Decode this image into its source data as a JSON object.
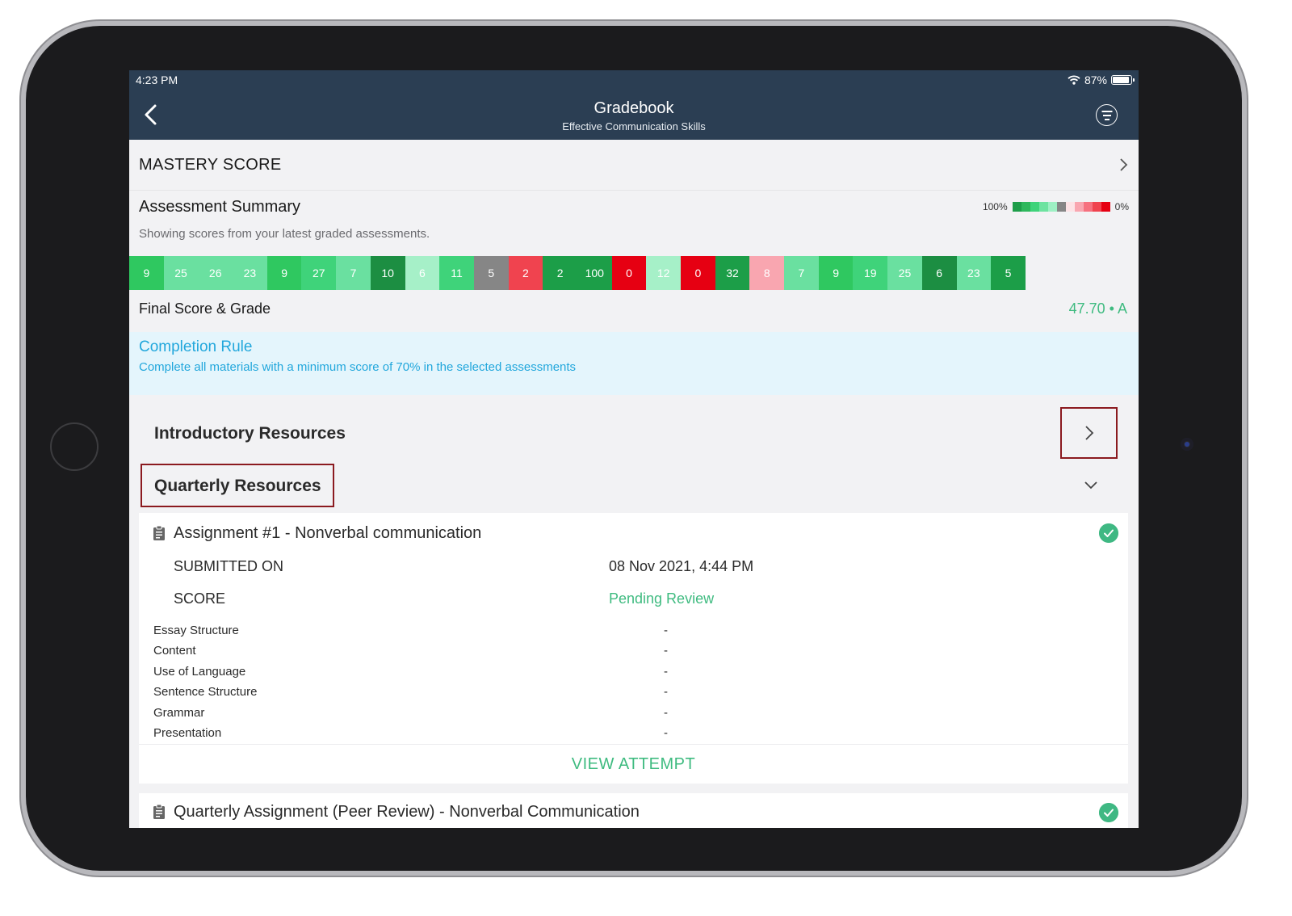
{
  "status": {
    "time": "4:23 PM",
    "battery": "87%"
  },
  "header": {
    "title": "Gradebook",
    "subtitle": "Effective Communication Skills"
  },
  "mastery": {
    "label": "MASTERY SCORE"
  },
  "summary": {
    "title": "Assessment Summary",
    "note": "Showing scores from your latest graded assessments.",
    "legend_high": "100%",
    "legend_low": "0%",
    "legend_colors": [
      "#1e9e4a",
      "#2eb85c",
      "#3fd37a",
      "#6ee3a0",
      "#9ef0c4",
      "#868686",
      "#fde3e6",
      "#f9a6b0",
      "#f6717f",
      "#f0434f",
      "#e60012"
    ],
    "scores": [
      {
        "v": "9",
        "c": "#2fc860"
      },
      {
        "v": "25",
        "c": "#6ae0a0"
      },
      {
        "v": "26",
        "c": "#6ae0a0"
      },
      {
        "v": "23",
        "c": "#6ae0a0"
      },
      {
        "v": "9",
        "c": "#2fc860"
      },
      {
        "v": "27",
        "c": "#3fd37a"
      },
      {
        "v": "7",
        "c": "#6ae0a0"
      },
      {
        "v": "10",
        "c": "#1c8e42"
      },
      {
        "v": "6",
        "c": "#a6f0c8"
      },
      {
        "v": "11",
        "c": "#3fd37a"
      },
      {
        "v": "5",
        "c": "#868686"
      },
      {
        "v": "2",
        "c": "#f0434f"
      },
      {
        "v": "2",
        "c": "#1c9e48"
      },
      {
        "v": "100",
        "c": "#1c9e48"
      },
      {
        "v": "0",
        "c": "#e60012"
      },
      {
        "v": "12",
        "c": "#a6f0c8"
      },
      {
        "v": "0",
        "c": "#e60012"
      },
      {
        "v": "32",
        "c": "#1c9e48"
      },
      {
        "v": "8",
        "c": "#f9a6b0"
      },
      {
        "v": "7",
        "c": "#6ae0a0"
      },
      {
        "v": "9",
        "c": "#2fc860"
      },
      {
        "v": "19",
        "c": "#3fd37a"
      },
      {
        "v": "25",
        "c": "#6ae0a0"
      },
      {
        "v": "6",
        "c": "#1c8e42"
      },
      {
        "v": "23",
        "c": "#6ae0a0"
      },
      {
        "v": "5",
        "c": "#1c9e48"
      }
    ]
  },
  "final": {
    "label": "Final Score & Grade",
    "value": "47.70 • A"
  },
  "rule": {
    "title": "Completion Rule",
    "text": "Complete all materials with a minimum score of 70% in the selected assessments"
  },
  "sections": {
    "intro": "Introductory Resources",
    "quarterly": "Quarterly Resources"
  },
  "assignment1": {
    "title": "Assignment #1 - Nonverbal communication",
    "submitted_label": "SUBMITTED ON",
    "submitted_value": "08 Nov 2021, 4:44 PM",
    "score_label": "SCORE",
    "score_value": "Pending Review",
    "criteria": [
      {
        "name": "Essay Structure",
        "val": "-"
      },
      {
        "name": "Content",
        "val": "-"
      },
      {
        "name": "Use of Language",
        "val": "-"
      },
      {
        "name": "Sentence Structure",
        "val": "-"
      },
      {
        "name": "Grammar",
        "val": "-"
      },
      {
        "name": "Presentation",
        "val": "-"
      }
    ],
    "view_label": "VIEW ATTEMPT"
  },
  "assignment2": {
    "title": "Quarterly Assignment (Peer Review) - Nonverbal Communication"
  }
}
